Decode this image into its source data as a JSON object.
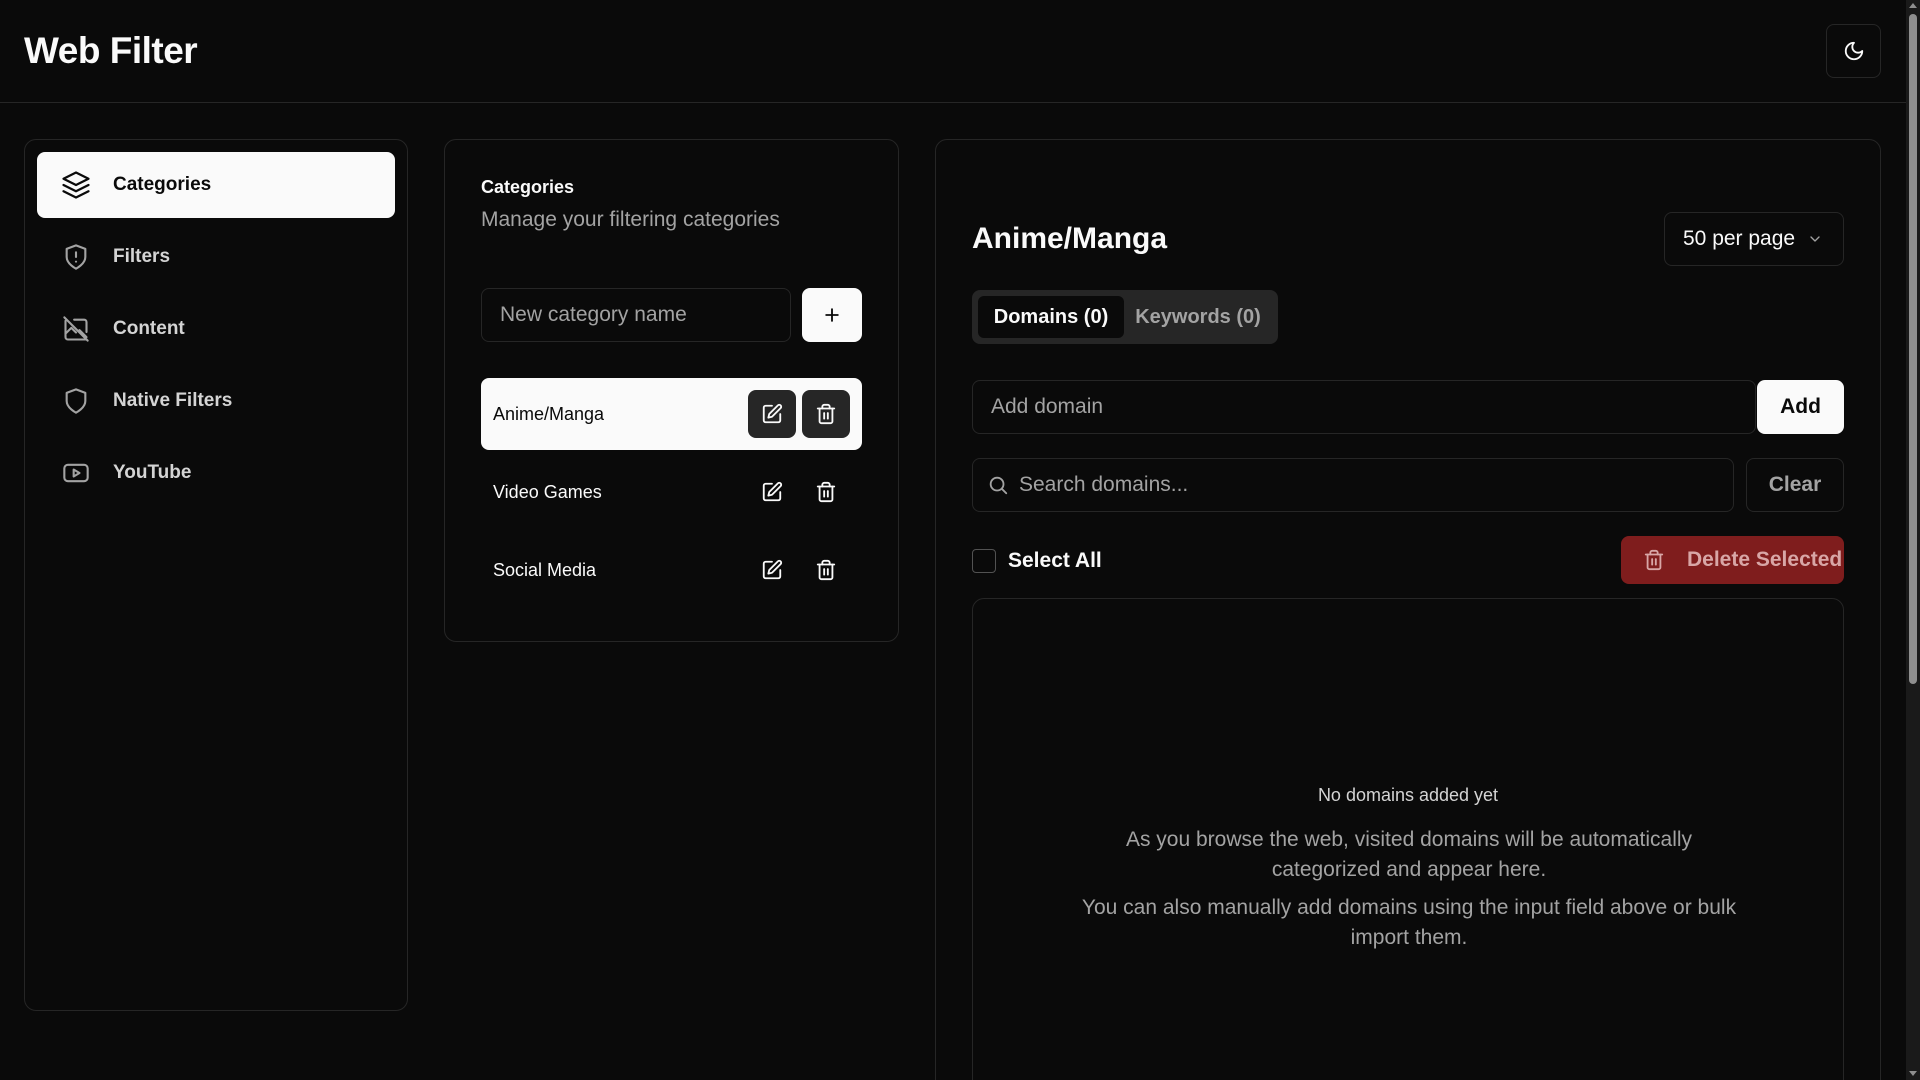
{
  "header": {
    "title": "Web Filter",
    "theme_icon": "moon-icon"
  },
  "sidebar": {
    "items": [
      {
        "label": "Categories",
        "icon": "layers-icon",
        "active": true
      },
      {
        "label": "Filters",
        "icon": "shield-alert-icon",
        "active": false
      },
      {
        "label": "Content",
        "icon": "image-off-icon",
        "active": false
      },
      {
        "label": "Native Filters",
        "icon": "shield-icon",
        "active": false
      },
      {
        "label": "YouTube",
        "icon": "youtube-icon",
        "active": false
      }
    ]
  },
  "categories_panel": {
    "title": "Categories",
    "subtitle": "Manage your filtering categories",
    "new_placeholder": "New category name",
    "add_label": "+",
    "items": [
      {
        "name": "Anime/Manga",
        "active": true
      },
      {
        "name": "Video Games",
        "active": false
      },
      {
        "name": "Social Media",
        "active": false
      }
    ]
  },
  "main": {
    "title": "Anime/Manga",
    "per_page": "50 per page",
    "tabs": [
      {
        "label": "Domains (0)",
        "active": true
      },
      {
        "label": "Keywords (0)",
        "active": false
      }
    ],
    "add_domain_placeholder": "Add domain",
    "add_label": "Add",
    "search_placeholder": "Search domains...",
    "clear_label": "Clear",
    "select_all_label": "Select All",
    "delete_selected_label": "Delete Selected",
    "empty": {
      "title": "No domains added yet",
      "line1": "As you browse the web, visited domains will be automatically categorized and appear here.",
      "line2": "You can also manually add domains using the input field above or bulk import them."
    }
  },
  "colors": {
    "background": "#0a0a0a",
    "foreground": "#fafafa",
    "border": "#262626",
    "muted": "#a3a3a3",
    "destructive": "#7f1d1d"
  }
}
